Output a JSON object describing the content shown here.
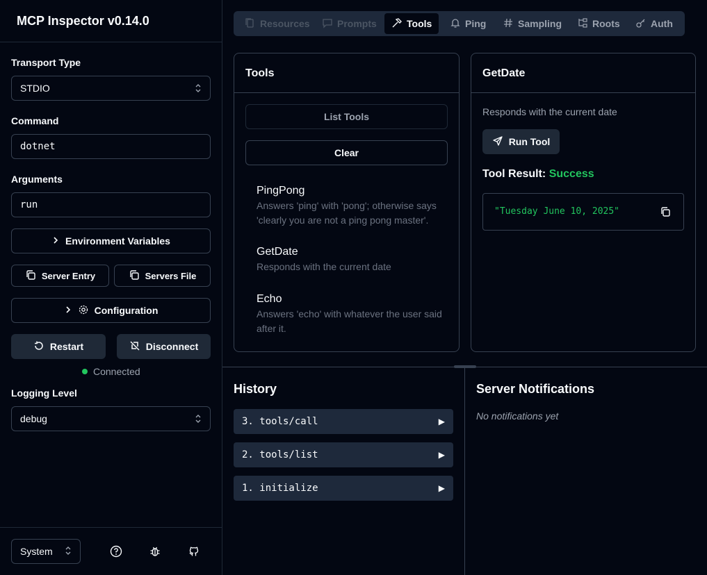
{
  "app": {
    "title": "MCP Inspector v0.14.0"
  },
  "sidebar": {
    "transport_label": "Transport Type",
    "transport_value": "STDIO",
    "command_label": "Command",
    "command_value": "dotnet",
    "arguments_label": "Arguments",
    "arguments_value": "run",
    "env_button": "Environment Variables",
    "server_entry_button": "Server Entry",
    "servers_file_button": "Servers File",
    "configuration_button": "Configuration",
    "restart_button": "Restart",
    "disconnect_button": "Disconnect",
    "status_text": "Connected",
    "status_color": "#22c55e",
    "logging_label": "Logging Level",
    "logging_value": "debug",
    "theme_value": "System"
  },
  "tabs": [
    {
      "label": "Resources",
      "icon": "files-icon",
      "state": "disabled"
    },
    {
      "label": "Prompts",
      "icon": "message-icon",
      "state": "disabled"
    },
    {
      "label": "Tools",
      "icon": "hammer-icon",
      "state": "active"
    },
    {
      "label": "Ping",
      "icon": "bell-icon",
      "state": "normal"
    },
    {
      "label": "Sampling",
      "icon": "hash-icon",
      "state": "normal"
    },
    {
      "label": "Roots",
      "icon": "folder-tree-icon",
      "state": "normal"
    },
    {
      "label": "Auth",
      "icon": "key-icon",
      "state": "normal"
    }
  ],
  "tools_panel": {
    "title": "Tools",
    "list_button": "List Tools",
    "clear_button": "Clear",
    "items": [
      {
        "name": "PingPong",
        "description": "Answers 'ping' with 'pong'; otherwise says 'clearly you are not a ping pong master'."
      },
      {
        "name": "GetDate",
        "description": "Responds with the current date"
      },
      {
        "name": "Echo",
        "description": "Answers 'echo' with whatever the user said after it."
      }
    ]
  },
  "detail_panel": {
    "title": "GetDate",
    "description": "Responds with the current date",
    "run_button": "Run Tool",
    "result_label": "Tool Result:",
    "result_status": "Success",
    "success_color": "#22c55e",
    "result_value": "\"Tuesday June 10, 2025\""
  },
  "history": {
    "title": "History",
    "items": [
      {
        "label": "3. tools/call"
      },
      {
        "label": "2. tools/list"
      },
      {
        "label": "1. initialize"
      }
    ]
  },
  "notifications": {
    "title": "Server Notifications",
    "empty_text": "No notifications yet"
  }
}
